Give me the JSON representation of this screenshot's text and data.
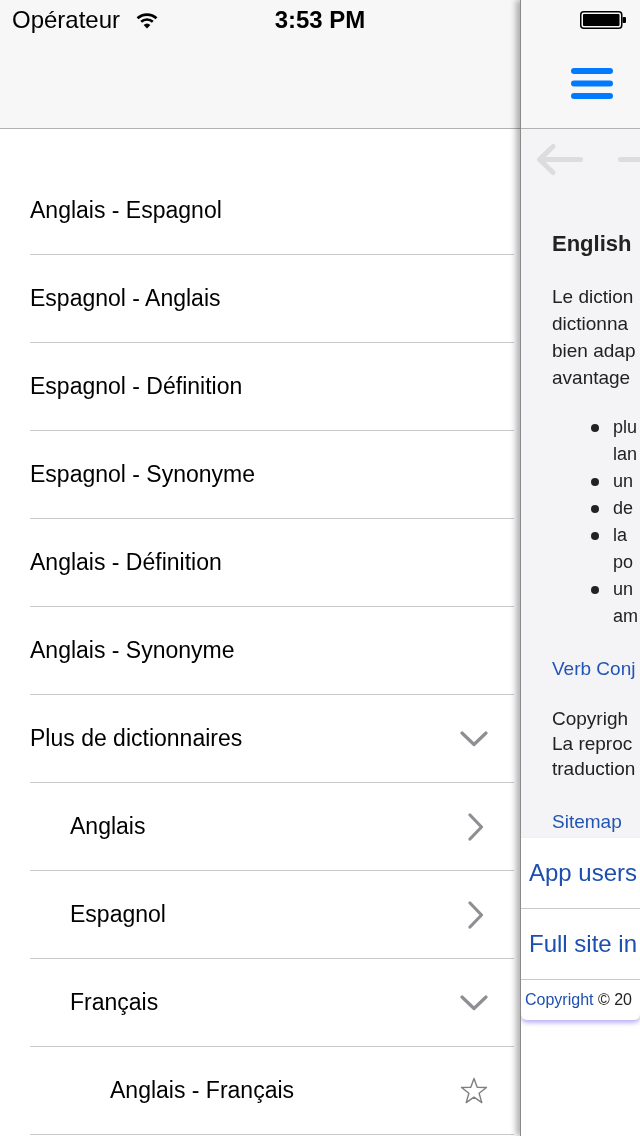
{
  "status_bar": {
    "carrier": "Opérateur",
    "time": "3:53 PM"
  },
  "menu": {
    "items": [
      {
        "kind": "entry",
        "label": "Anglais - Espagnol"
      },
      {
        "kind": "entry",
        "label": "Espagnol - Anglais"
      },
      {
        "kind": "entry",
        "label": "Espagnol - Définition"
      },
      {
        "kind": "entry",
        "label": "Espagnol - Synonyme"
      },
      {
        "kind": "entry",
        "label": "Anglais - Définition"
      },
      {
        "kind": "entry",
        "label": "Anglais - Synonyme"
      },
      {
        "kind": "group",
        "label": "Plus de dictionnaires",
        "expanded": true,
        "children": [
          {
            "kind": "group",
            "label": "Anglais",
            "expanded": false
          },
          {
            "kind": "group",
            "label": "Espagnol",
            "expanded": false
          },
          {
            "kind": "group",
            "label": "Français",
            "expanded": true,
            "children": [
              {
                "kind": "favorite",
                "label": "Anglais - Français",
                "starred": false
              }
            ]
          }
        ]
      }
    ]
  },
  "web_page": {
    "heading": "English",
    "intro_lines": [
      "Le diction",
      "dictionna",
      "bien adap",
      "avantage"
    ],
    "bullets": [
      [
        "plu",
        "lan"
      ],
      [
        "un"
      ],
      [
        "de"
      ],
      [
        "la",
        "po"
      ],
      [
        "un",
        "am"
      ]
    ],
    "conjugation_link": "Verb Conj",
    "copyright_lines": [
      "Copyrigh",
      "La reproc",
      "traduction"
    ],
    "sitemap_link": "Sitemap",
    "footer_links": [
      "App users",
      "Full site in"
    ],
    "footer_note": {
      "link": "Copyright",
      "text": "© 20"
    }
  }
}
